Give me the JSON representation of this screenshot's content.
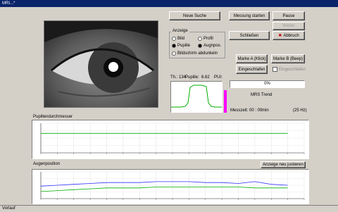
{
  "window": {
    "title": "MRI...*"
  },
  "buttons": {
    "neue_suche": "Neue Suche",
    "messung_starten": "Messung starten",
    "pause": "Pause",
    "weiter": "Weiter",
    "schliessen": "Schließen",
    "abbruch": "Abbruch",
    "marke_a": "Marke A (Klick)",
    "marke_b": "Marke B (Beep)",
    "eingeschlafen": "Eingeschlafen",
    "anzeige_neu_justieren": "Anzeige neu justieren"
  },
  "anzeige": {
    "label": "Anzeige",
    "options": {
      "bild": "Bild",
      "profil": "Profil",
      "pupille": "Pupille",
      "augpos": "Augnpos."
    },
    "screen_off": "Bildschirm abdunkeln"
  },
  "checkbox_eingeschlafen": "Eingeschlafen",
  "profile": {
    "th_label": "Th.: 134",
    "pupille_label": "Pupille:",
    "pupille_value": "6.62",
    "pui_label": "PUI:"
  },
  "progress": {
    "text": "0%",
    "value": 0
  },
  "mrs_trend": "MRS Trend",
  "messzeit": {
    "label": "Messzeit: 00 : 00",
    "unit": "min",
    "rate": "(25 Hz)"
  },
  "panels": {
    "pupil_title": "Pupillendurchmesser",
    "eye_title": "Augenposition"
  },
  "statusbar": {
    "text": "Vorlauf"
  },
  "colors": {
    "trace_green": "#00b000",
    "trace_blue": "#3030ff",
    "magenta": "#ff00ff",
    "titlebar": "#0a246a"
  },
  "chart_data": [
    {
      "type": "line",
      "title": "Pupillendurchmesser",
      "x": [
        0,
        5,
        10,
        15,
        20,
        25,
        30,
        35,
        40,
        45,
        50,
        55,
        60,
        65,
        70,
        75
      ],
      "series": [
        {
          "values": [
            6.6,
            6.6,
            6.6,
            6.6,
            6.6,
            6.6,
            6.6,
            6.6,
            6.6,
            6.6,
            6.6,
            6.6,
            6.6,
            6.6,
            6.6,
            6.6
          ]
        }
      ],
      "xlim": [
        0,
        80
      ]
    },
    {
      "type": "line",
      "title": "Augenposition",
      "x": [
        0,
        5,
        10,
        15,
        20,
        25,
        30,
        35,
        40,
        45,
        50,
        55,
        60,
        65,
        70,
        75
      ],
      "series": [
        {
          "values": [
            0.4,
            0.5,
            0.6,
            0.7,
            0.8,
            0.8,
            0.8,
            0.9,
            0.9,
            0.9,
            0.8,
            0.8,
            0.7,
            0.9,
            0.6,
            0.5
          ]
        },
        {
          "values": [
            -0.2,
            -0.1,
            0,
            0.1,
            0.2,
            0.2,
            0.2,
            0.3,
            0.3,
            0.3,
            0.3,
            0.3,
            0.3,
            0.2,
            0.2,
            0.2
          ]
        }
      ],
      "xlim": [
        0,
        80
      ]
    }
  ]
}
